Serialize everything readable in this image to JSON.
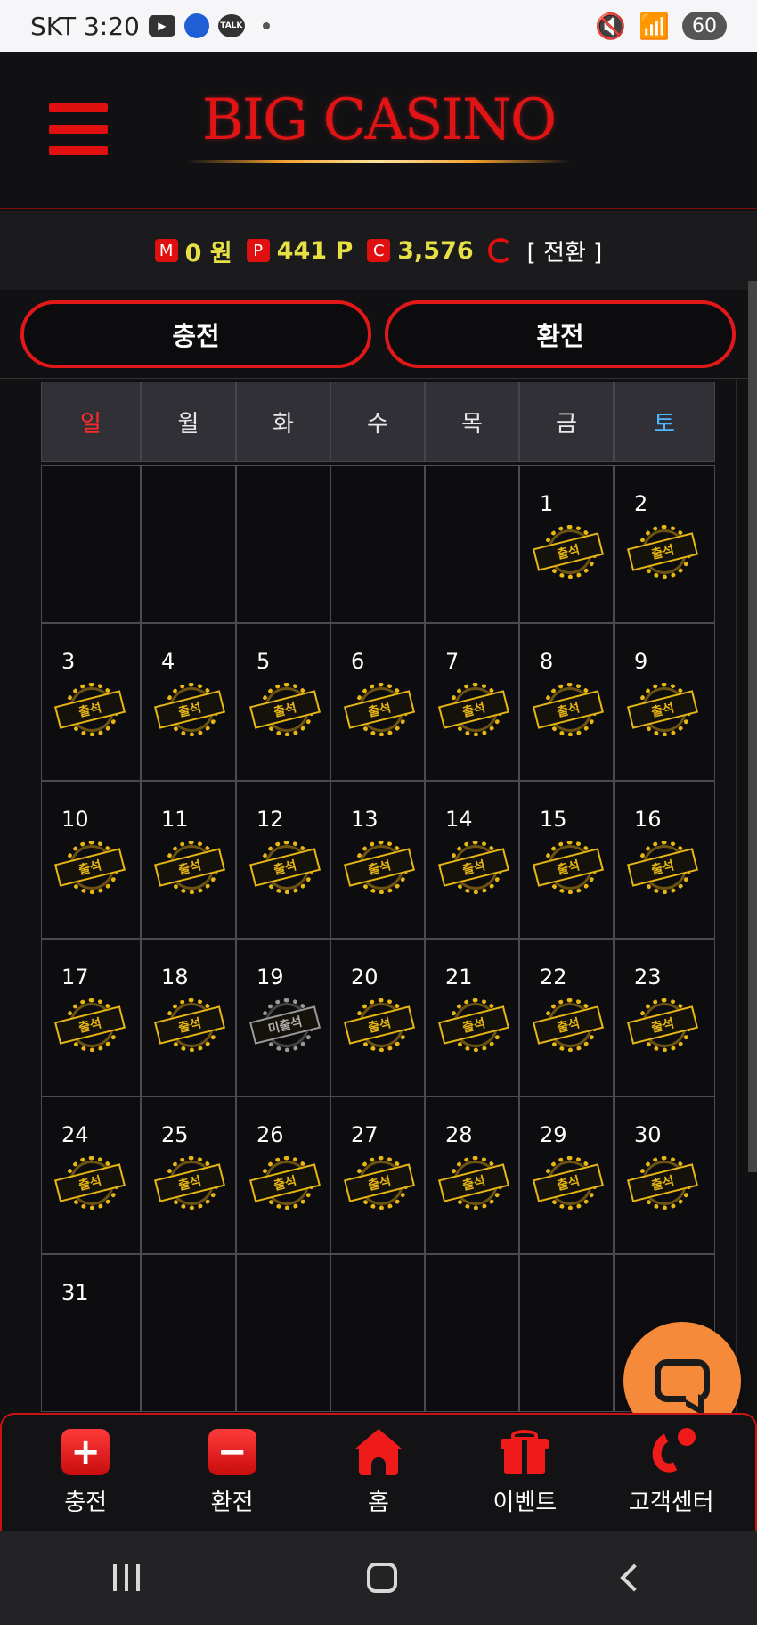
{
  "status_bar": {
    "carrier_time": "SKT 3:20",
    "talk_label": "TALK",
    "battery": "60"
  },
  "header": {
    "logo": "BIG CASINO"
  },
  "balances": {
    "money_badge": "M",
    "money": "0 원",
    "point_badge": "P",
    "points": "441 P",
    "coin_badge": "C",
    "coins": "3,576",
    "convert_label": "[ 전환 ]"
  },
  "actions": {
    "charge": "충전",
    "exchange": "환전"
  },
  "calendar": {
    "weekdays": [
      "일",
      "월",
      "화",
      "수",
      "목",
      "금",
      "토"
    ],
    "stamp_present": "출석",
    "stamp_absent": "미출석",
    "days": [
      {
        "num": "",
        "status": ""
      },
      {
        "num": "",
        "status": ""
      },
      {
        "num": "",
        "status": ""
      },
      {
        "num": "",
        "status": ""
      },
      {
        "num": "",
        "status": ""
      },
      {
        "num": "1",
        "status": "present"
      },
      {
        "num": "2",
        "status": "present"
      },
      {
        "num": "3",
        "status": "present"
      },
      {
        "num": "4",
        "status": "present"
      },
      {
        "num": "5",
        "status": "present"
      },
      {
        "num": "6",
        "status": "present"
      },
      {
        "num": "7",
        "status": "present"
      },
      {
        "num": "8",
        "status": "present"
      },
      {
        "num": "9",
        "status": "present"
      },
      {
        "num": "10",
        "status": "present"
      },
      {
        "num": "11",
        "status": "present"
      },
      {
        "num": "12",
        "status": "present"
      },
      {
        "num": "13",
        "status": "present"
      },
      {
        "num": "14",
        "status": "present"
      },
      {
        "num": "15",
        "status": "present"
      },
      {
        "num": "16",
        "status": "present"
      },
      {
        "num": "17",
        "status": "present"
      },
      {
        "num": "18",
        "status": "present"
      },
      {
        "num": "19",
        "status": "absent"
      },
      {
        "num": "20",
        "status": "present"
      },
      {
        "num": "21",
        "status": "present"
      },
      {
        "num": "22",
        "status": "present"
      },
      {
        "num": "23",
        "status": "present"
      },
      {
        "num": "24",
        "status": "present"
      },
      {
        "num": "25",
        "status": "present"
      },
      {
        "num": "26",
        "status": "present"
      },
      {
        "num": "27",
        "status": "present"
      },
      {
        "num": "28",
        "status": "present"
      },
      {
        "num": "29",
        "status": "present"
      },
      {
        "num": "30",
        "status": "present"
      },
      {
        "num": "31",
        "status": ""
      },
      {
        "num": "",
        "status": ""
      },
      {
        "num": "",
        "status": ""
      },
      {
        "num": "",
        "status": ""
      },
      {
        "num": "",
        "status": ""
      },
      {
        "num": "",
        "status": ""
      },
      {
        "num": "",
        "status": ""
      }
    ]
  },
  "bottom_nav": [
    {
      "label": "충전",
      "icon": "plus-icon"
    },
    {
      "label": "환전",
      "icon": "minus-icon"
    },
    {
      "label": "홈",
      "icon": "home-icon"
    },
    {
      "label": "이벤트",
      "icon": "gift-icon"
    },
    {
      "label": "고객센터",
      "icon": "phone-icon"
    }
  ],
  "colors": {
    "accent": "#e01010",
    "stamp_gold": "#e8b714",
    "balance_yellow": "#e6e045",
    "chat_orange": "#f58a3a"
  }
}
